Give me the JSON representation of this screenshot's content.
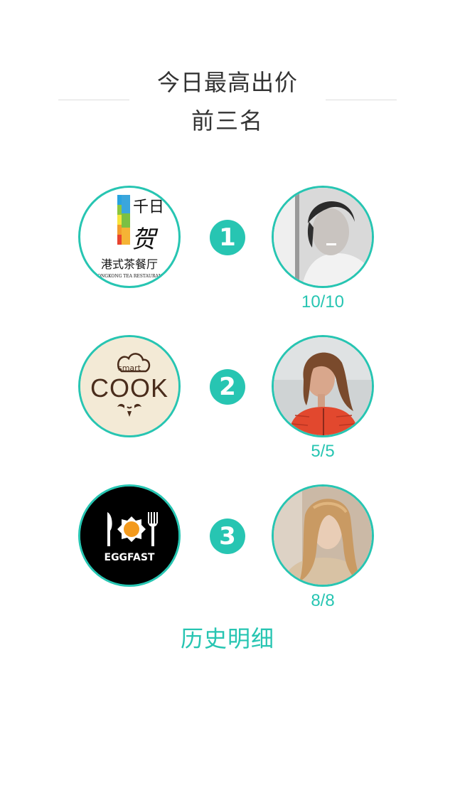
{
  "header": {
    "title_line1": "今日最高出价",
    "title_line2": "前三名"
  },
  "colors": {
    "accent": "#27c5b2",
    "title_text": "#333333",
    "divider": "#dddddd"
  },
  "rankings": [
    {
      "rank": "1",
      "restaurant": {
        "logo_icon": "qianrihe-restaurant-logo",
        "logo_text_top": "千日",
        "logo_text_bottom": "港式茶餐厅",
        "logo_text_en": "HONGKONG TEA RESTAURANT"
      },
      "user_avatar_icon": "user-avatar-male",
      "score": "10/10"
    },
    {
      "rank": "2",
      "restaurant": {
        "logo_icon": "smart-cook-logo",
        "logo_text_small": "smart",
        "logo_text_main": "COOK"
      },
      "user_avatar_icon": "user-avatar-female-red-jacket",
      "score": "5/5"
    },
    {
      "rank": "3",
      "restaurant": {
        "logo_icon": "eggfast-logo",
        "logo_text": "EGGFAST"
      },
      "user_avatar_icon": "user-avatar-female-blonde",
      "score": "8/8"
    }
  ],
  "history_link": "历史明细"
}
